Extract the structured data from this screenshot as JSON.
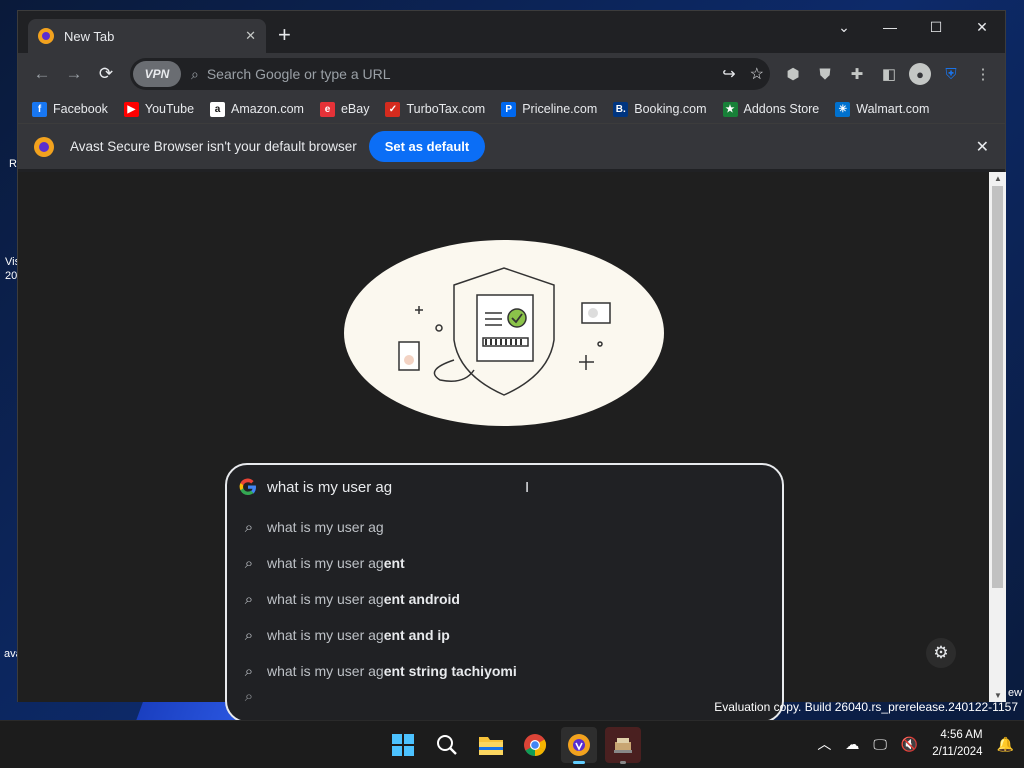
{
  "browser": {
    "tab_title": "New Tab",
    "new_tab_symbol": "+",
    "window_controls": [
      "⌄",
      "—",
      "☐",
      "✕"
    ]
  },
  "toolbar": {
    "vpn_label": "VPN",
    "omnibox_placeholder": "Search Google or type a URL"
  },
  "bookmarks": [
    {
      "label": "Facebook",
      "icon": "facebook-icon",
      "letter": "f",
      "color": "#1877f2"
    },
    {
      "label": "YouTube",
      "icon": "youtube-icon",
      "letter": "▶",
      "color": "#ff0000"
    },
    {
      "label": "Amazon.com",
      "icon": "amazon-icon",
      "letter": "a",
      "color": "#ffffff"
    },
    {
      "label": "eBay",
      "icon": "ebay-icon",
      "letter": "e",
      "color": "#e53238"
    },
    {
      "label": "TurboTax.com",
      "icon": "turbotax-icon",
      "letter": "✓",
      "color": "#d52b1e"
    },
    {
      "label": "Priceline.com",
      "icon": "priceline-icon",
      "letter": "P",
      "color": "#0068ef"
    },
    {
      "label": "Booking.com",
      "icon": "booking-icon",
      "letter": "B.",
      "color": "#003580"
    },
    {
      "label": "Addons Store",
      "icon": "addons-icon",
      "letter": "★",
      "color": "#188038"
    },
    {
      "label": "Walmart.com",
      "icon": "walmart-icon",
      "letter": "✳",
      "color": "#0071ce"
    }
  ],
  "infobar": {
    "message": "Avast Secure Browser isn't your default browser",
    "button": "Set as default"
  },
  "search": {
    "query": "what is my user ag",
    "suggestions": [
      {
        "plain": "what is my user ag",
        "bold": ""
      },
      {
        "plain": "what is my user ag",
        "bold": "ent"
      },
      {
        "plain": "what is my user ag",
        "bold": "ent android"
      },
      {
        "plain": "what is my user ag",
        "bold": "ent and ip"
      },
      {
        "plain": "what is my user ag",
        "bold": "ent string tachiyomi"
      }
    ]
  },
  "desktop": {
    "fragments": [
      "Re",
      "Vis",
      "20",
      "ava",
      "ew"
    ],
    "watermark": "Evaluation copy. Build 26040.rs_prerelease.240122-1157"
  },
  "taskbar": {
    "time": "4:56 AM",
    "date": "2/11/2024",
    "colors": {
      "accent": "#60cdff"
    }
  }
}
